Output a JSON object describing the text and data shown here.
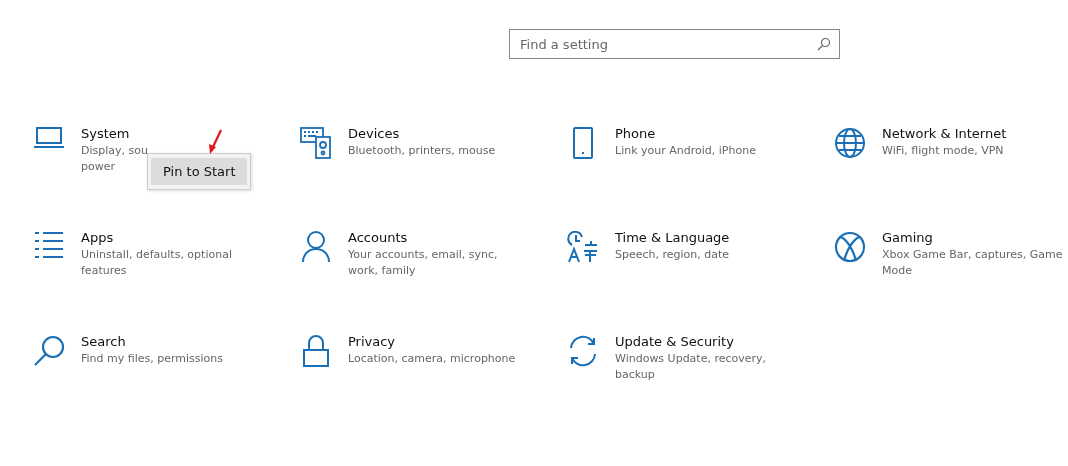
{
  "search": {
    "placeholder": "Find a setting"
  },
  "categories": [
    {
      "title": "System",
      "description_lines": [
        "Display, sou",
        "power"
      ]
    },
    {
      "title": "Devices",
      "description_lines": [
        "Bluetooth, printers, mouse"
      ]
    },
    {
      "title": "Phone",
      "description_lines": [
        "Link your Android, iPhone"
      ]
    },
    {
      "title": "Network & Internet",
      "description_lines": [
        "WiFi, flight mode, VPN"
      ]
    },
    {
      "title": "Apps",
      "description_lines": [
        "Uninstall, defaults, optional",
        "features"
      ]
    },
    {
      "title": "Accounts",
      "description_lines": [
        "Your accounts, email, sync,",
        "work, family"
      ]
    },
    {
      "title": "Time & Language",
      "description_lines": [
        "Speech, region, date"
      ]
    },
    {
      "title": "Gaming",
      "description_lines": [
        "Xbox Game Bar, captures, Game",
        "Mode"
      ]
    },
    {
      "title": "Search",
      "description_lines": [
        "Find my files, permissions"
      ]
    },
    {
      "title": "Privacy",
      "description_lines": [
        "Location, camera, microphone"
      ]
    },
    {
      "title": "Update & Security",
      "description_lines": [
        "Windows Update, recovery,",
        "backup"
      ]
    }
  ],
  "context_menu": {
    "items": [
      "Pin to Start"
    ]
  }
}
